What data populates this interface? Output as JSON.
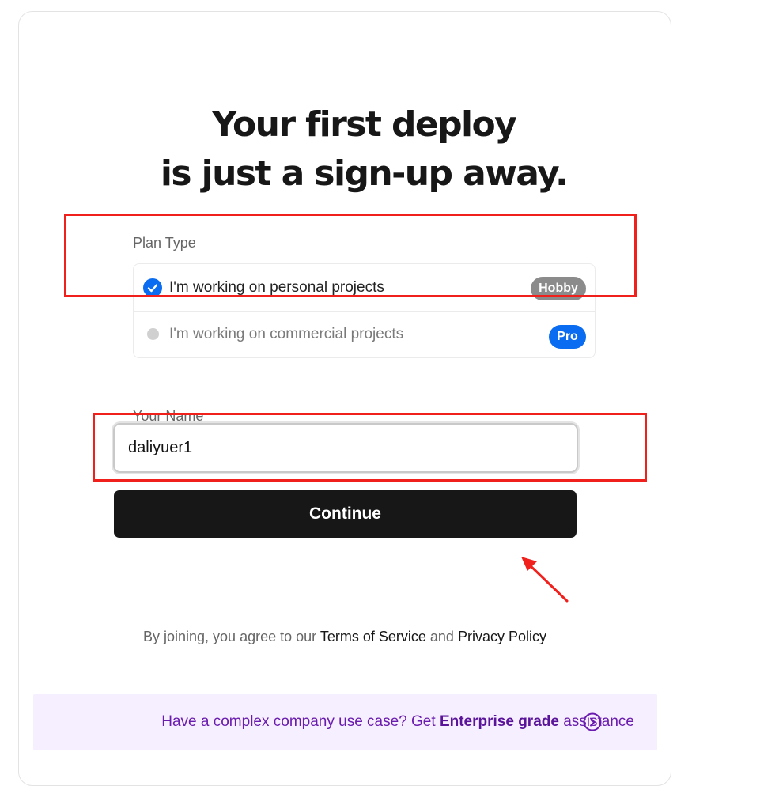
{
  "headline": {
    "line1": "Your first deploy",
    "line2": "is just a sign-up away."
  },
  "plan_type": {
    "label": "Plan Type",
    "options": [
      {
        "text": "I'm working on personal projects",
        "badge": "Hobby",
        "selected": true
      },
      {
        "text": "I'm working on commercial projects",
        "badge": "Pro",
        "selected": false
      }
    ]
  },
  "name_field": {
    "label": "Your Name",
    "value": "daliyuer1"
  },
  "continue_button": "Continue",
  "terms": {
    "prefix": "By joining, you agree to our",
    "terms_link": "Terms of Service",
    "conjunction": "and",
    "privacy_link": "Privacy Policy"
  },
  "enterprise": {
    "prefix": "Have a complex company use case? Get",
    "link": "Enterprise grade",
    "suffix": "assistance",
    "icon": "chevron-right-circle-icon"
  },
  "colors": {
    "accent_blue": "#0a6cf0",
    "button_dark": "#171717",
    "enterprise_bg": "#f6efff",
    "enterprise_text": "#6a1cae",
    "annotation_red": "#f0201c"
  }
}
